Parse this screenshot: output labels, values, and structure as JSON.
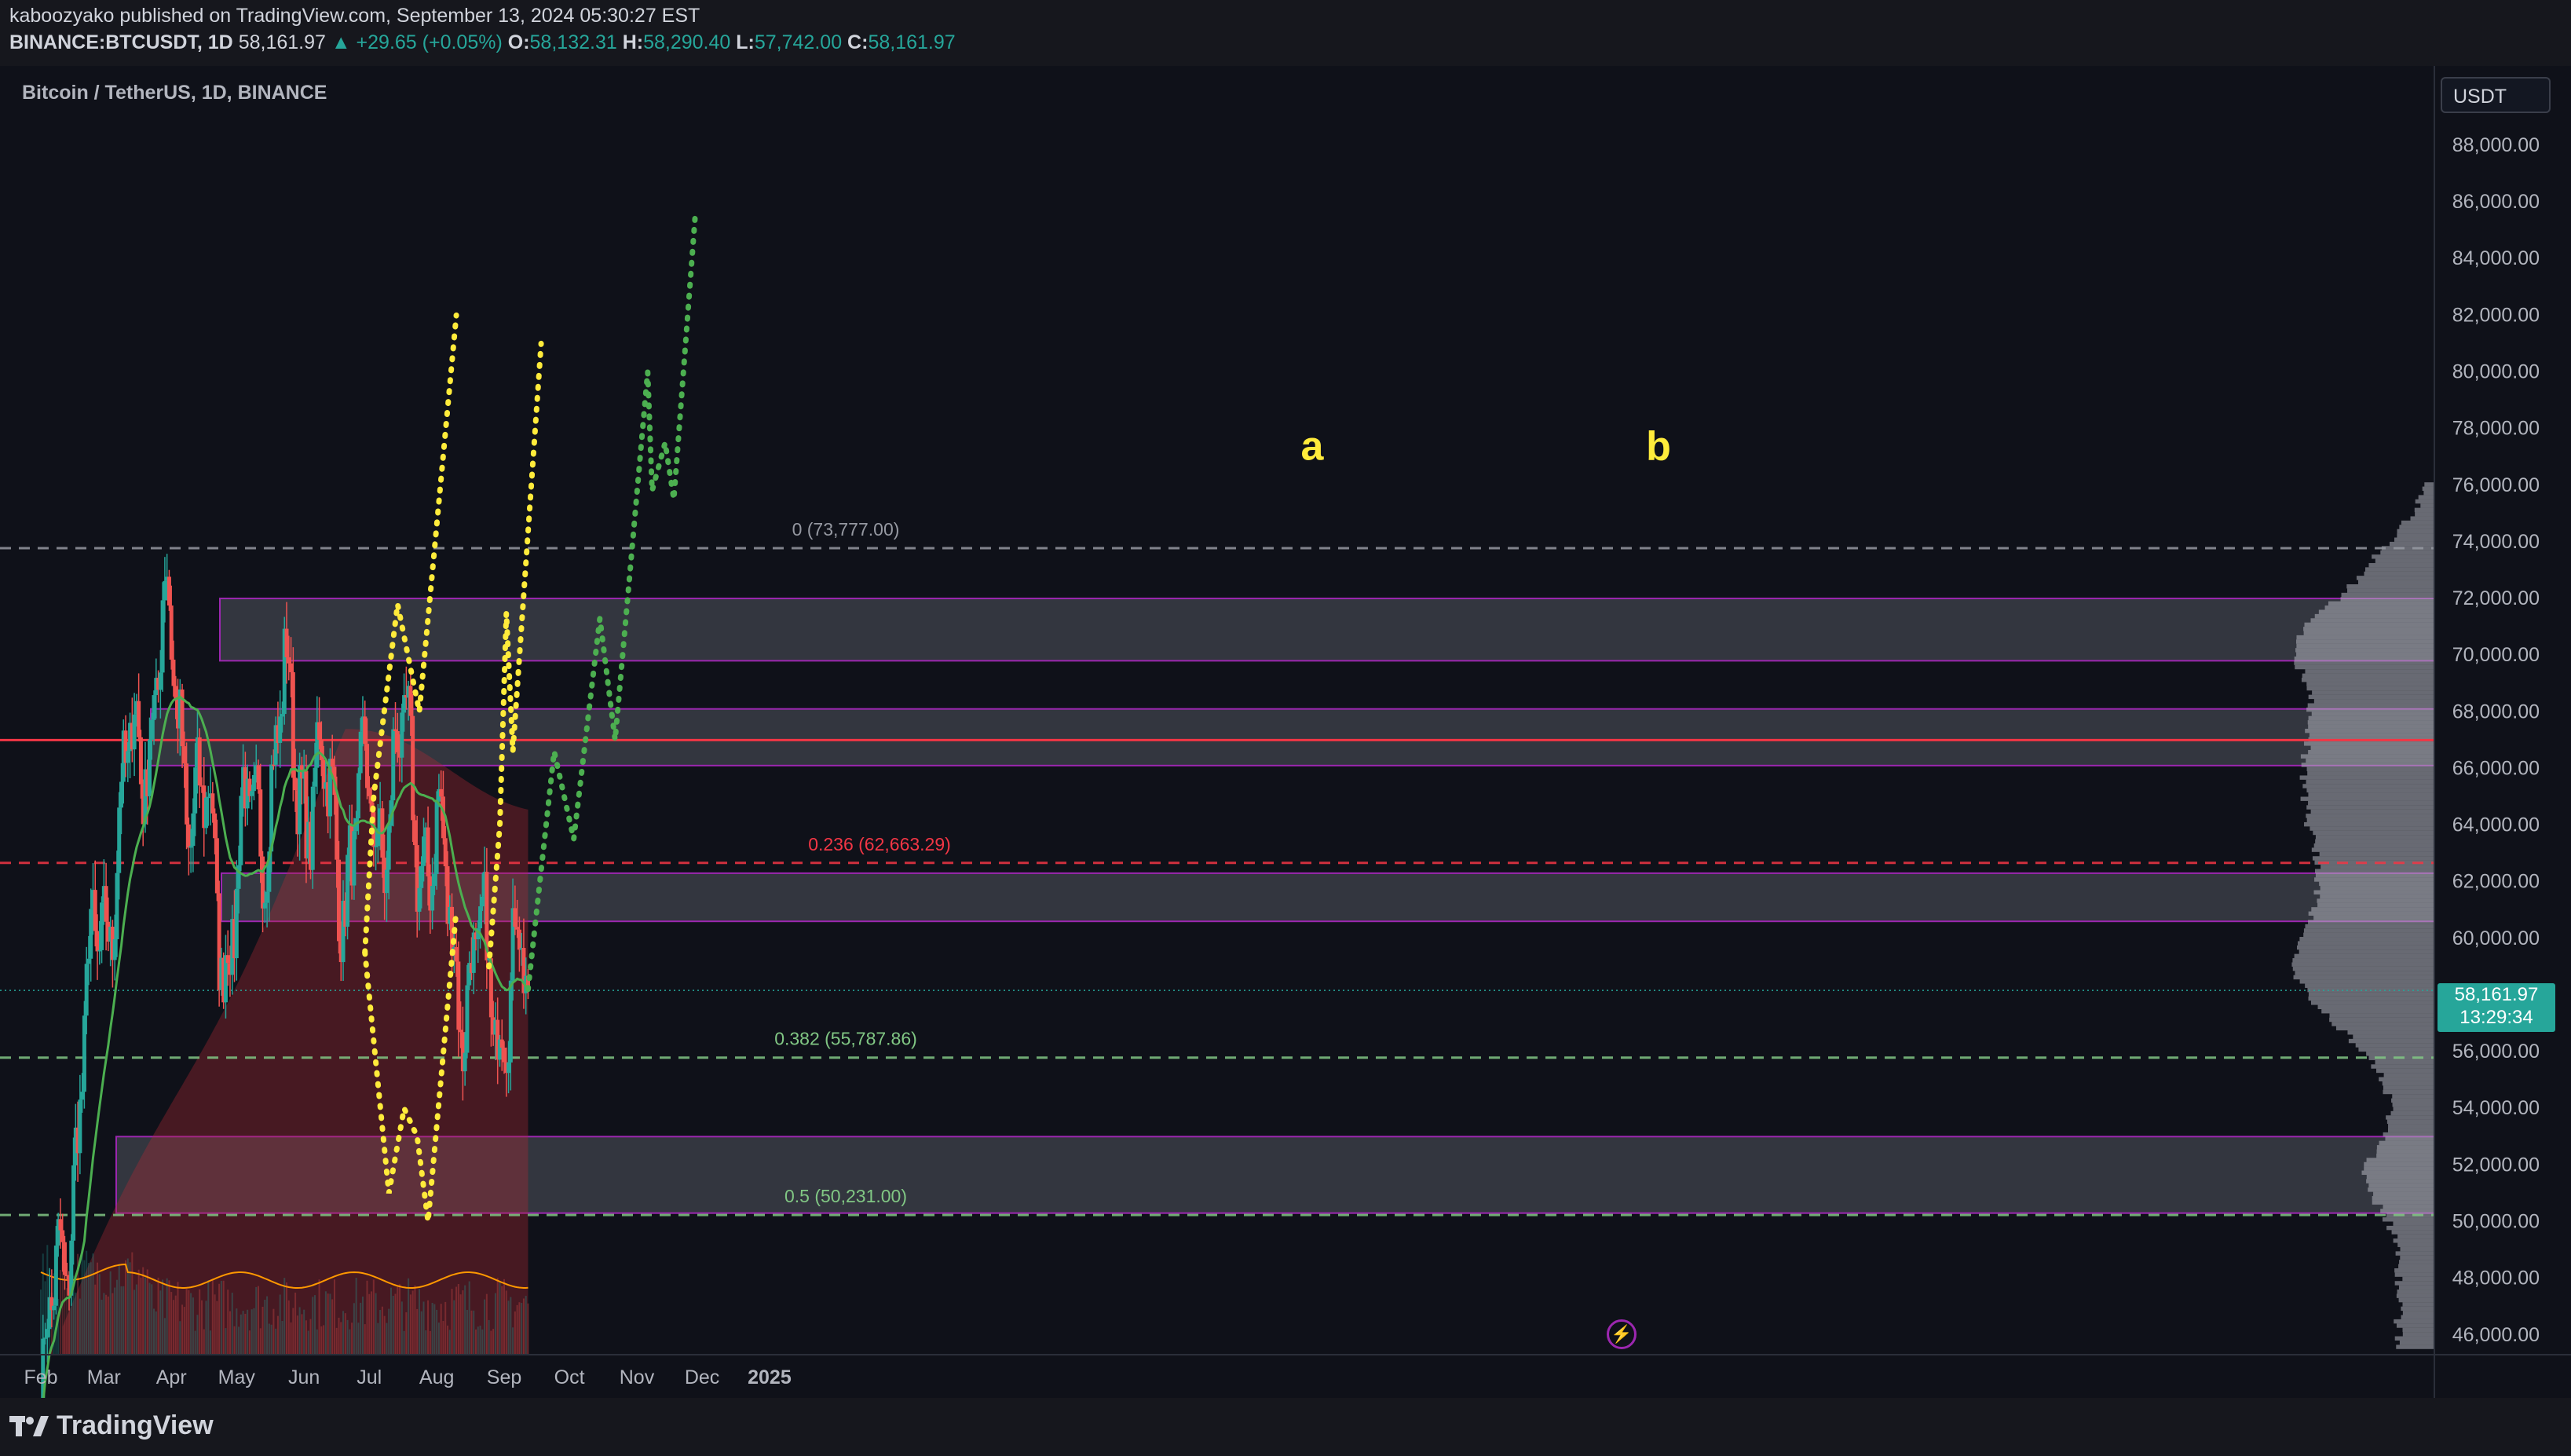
{
  "header": {
    "publisher_line": "kaboozyako published on TradingView.com, September 13, 2024 05:30:27 EST",
    "symbol": "BINANCE:BTCUSDT, 1D",
    "last_price": "58,161.97",
    "change": "▲ +29.65 (+0.05%)",
    "o_label": "O:",
    "o_value": "58,132.31",
    "h_label": "H:",
    "h_value": "58,290.40",
    "l_label": "L:",
    "l_value": "57,742.00",
    "c_label": "C:",
    "c_value": "58,161.97"
  },
  "symbol_title": "Bitcoin / TetherUS, 1D, BINANCE",
  "currency_button": "USDT",
  "price_tag": {
    "price": "58,161.97",
    "countdown": "13:29:34"
  },
  "footer": {
    "brand": "TradingView"
  },
  "colors": {
    "background": "#0f1119",
    "up_candle": "#26a69a",
    "down_candle": "#ef5350",
    "ma_line": "#4caf50",
    "projection_yellow": "#ffeb3b",
    "projection_green": "#4caf50",
    "zone_border": "#9c27b0",
    "resistance_red": "#f23645"
  },
  "chart_data": {
    "type": "candlestick",
    "x_axis_labels": [
      "Feb",
      "Mar",
      "Apr",
      "May",
      "Jun",
      "Jul",
      "Aug",
      "Sep",
      "Oct",
      "Nov",
      "Dec",
      "2025"
    ],
    "y_ticks": [
      "88,000.00",
      "86,000.00",
      "84,000.00",
      "82,000.00",
      "80,000.00",
      "78,000.00",
      "76,000.00",
      "74,000.00",
      "72,000.00",
      "70,000.00",
      "68,000.00",
      "66,000.00",
      "64,000.00",
      "62,000.00",
      "60,000.00",
      "58,000.00",
      "56,000.00",
      "54,000.00",
      "52,000.00",
      "50,000.00",
      "48,000.00",
      "46,000.00"
    ],
    "ylim": [
      45300,
      90800
    ],
    "months": [
      "Feb",
      "Mar",
      "Apr",
      "May",
      "Jun",
      "Jul",
      "Aug",
      "Sep"
    ],
    "monthly_path": [
      42500,
      61000,
      70500,
      60500,
      67500,
      63000,
      66000,
      58500,
      58160
    ],
    "last_close": 58161.97,
    "fib_levels": [
      {
        "label": "0 (73,777.00)",
        "price": 73777,
        "color": "#9598a1"
      },
      {
        "label": "0.236 (62,663.29)",
        "price": 62663.29,
        "color": "#f23645"
      },
      {
        "label": "0.382 (55,787.86)",
        "price": 55787.86,
        "color": "#81c784"
      },
      {
        "label": "0.5 (50,231.00)",
        "price": 50231,
        "color": "#81c784"
      }
    ],
    "resistance_line": 67000,
    "zones": [
      {
        "low": 69800,
        "high": 72000
      },
      {
        "low": 66100,
        "high": 68100
      },
      {
        "low": 60600,
        "high": 62300
      },
      {
        "low": 50300,
        "high": 53000
      }
    ],
    "projections": [
      {
        "name": "a",
        "color": "yellow",
        "points": [
          [
            "2024-06-29",
            59500
          ],
          [
            "2024-07-03",
            65000
          ],
          [
            "2024-07-14",
            71800
          ],
          [
            "2024-07-24",
            68000
          ],
          [
            "2024-08-10",
            82000
          ]
        ]
      },
      {
        "name": "a-low",
        "color": "yellow",
        "points": [
          [
            "2024-06-29",
            59500
          ],
          [
            "2024-07-10",
            51000
          ],
          [
            "2024-07-17",
            54000
          ],
          [
            "2024-07-23",
            53000
          ],
          [
            "2024-07-28",
            50000
          ],
          [
            "2024-08-10",
            61000
          ]
        ]
      },
      {
        "name": "b",
        "color": "yellow",
        "points": [
          [
            "2024-08-25",
            59000
          ],
          [
            "2024-08-30",
            64000
          ],
          [
            "2024-09-02",
            71500
          ],
          [
            "2024-09-05",
            66600
          ],
          [
            "2024-09-18",
            81000
          ]
        ]
      },
      {
        "name": "",
        "color": "green",
        "points": [
          [
            "2024-09-12",
            58200
          ],
          [
            "2024-09-24",
            66600
          ],
          [
            "2024-10-03",
            63500
          ],
          [
            "2024-10-15",
            71300
          ],
          [
            "2024-10-22",
            67000
          ],
          [
            "2024-11-06",
            80000
          ],
          [
            "2024-11-08",
            75800
          ],
          [
            "2024-11-14",
            77500
          ],
          [
            "2024-11-18",
            75500
          ],
          [
            "2024-11-28",
            85700
          ]
        ]
      }
    ],
    "wave_labels": [
      {
        "text": "a",
        "date": "2024-07-30",
        "price": 76900
      },
      {
        "text": "b",
        "date": "2024-09-02",
        "price": 76900
      }
    ]
  }
}
